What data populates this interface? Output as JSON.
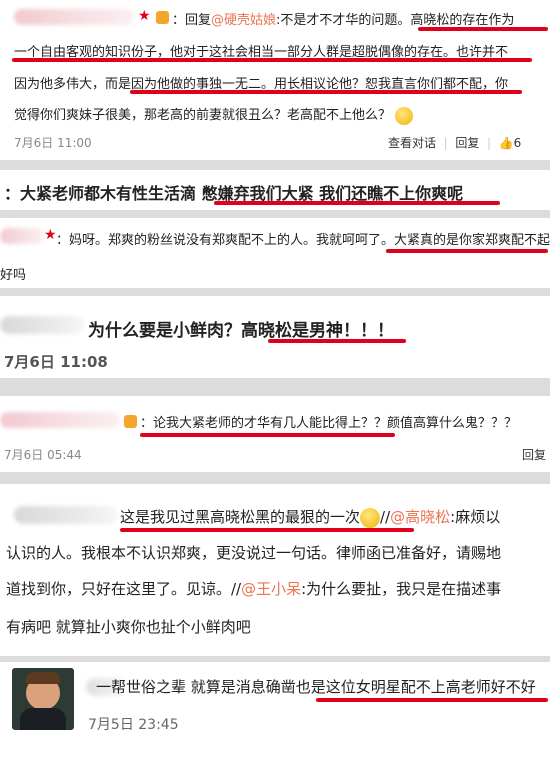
{
  "c1": {
    "reply_prefix": "：回复",
    "mention": "@硬壳姑娘",
    "line1_rest": ":不是才不才华的问题。高晓松的存在作为",
    "line2": "一个自由客观的知识份子，他对于这社会相当一部分人群是超脱偶像的存在。也许并不",
    "line3": "因为他多伟大，而是因为他做的事独一无二。用长相议论他？恕我直言你们都不配，你",
    "line4": "觉得你们爽妹子很美，那老高的前妻就很丑么？老高配不上他么？",
    "time": "7月6日 11:00",
    "action_view": "查看对话",
    "action_reply": "回复",
    "like_count": "6"
  },
  "c2": {
    "text_a": "：大紧老师都木有性生活滴 ",
    "text_b": "憋嫌弃我们大紧 我们还瞧不上你爽呢"
  },
  "c3": {
    "line1": "：妈呀。郑爽的粉丝说没有郑爽配不上的人。我就呵呵了。大紧真的是你家郑爽配不起的",
    "line2": "好吗"
  },
  "c4": {
    "text_a": "为什么要是小鲜肉？",
    "text_b": "高晓松是男神！！！",
    "time": "7月6日 11:08"
  },
  "c5": {
    "text": "：论我大紧老师的才华有几人能比得上？？颜值高算什么鬼？？？",
    "time": "7月6日 05:44",
    "action_reply": "回复"
  },
  "c6": {
    "line1_a": "这是我见过黑高晓松黑的最狠的一次",
    "line1_b": "//",
    "mention1": "@高晓松",
    "line1_c": ":麻烦以",
    "line2": "认识的人。我根本不认识郑爽，更没说过一句话。律师函已准备好，请赐地",
    "line3_a": "道找到你，只好在这里了。见谅。//",
    "mention2": "@王小呆",
    "line3_b": ":为什么要扯，我只是在描述事",
    "line4": "有病吧 就算扯小爽你也扯个小鲜肉吧"
  },
  "c7": {
    "text": "一帮世俗之辈 就算是消息确凿也是这位女明星配不上高老师好不好",
    "time": "7月5日 23:45"
  }
}
